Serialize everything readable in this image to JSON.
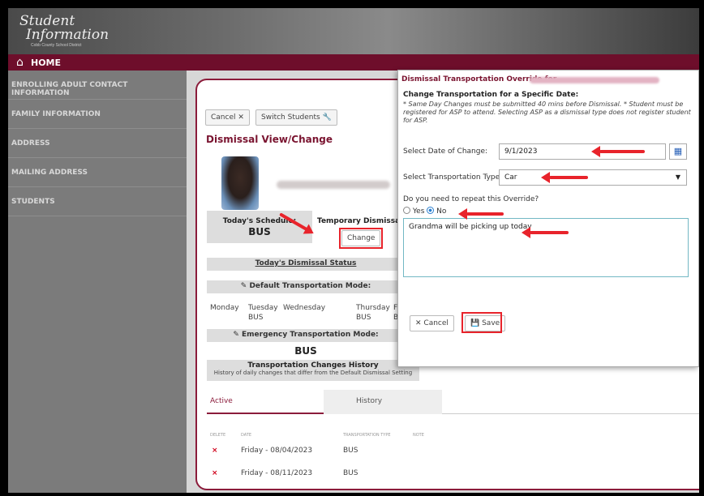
{
  "banner": {
    "logo_line1": "Student",
    "logo_line2": "Information",
    "logo_line3": "Cobb County School District"
  },
  "home": {
    "icon": "home-icon",
    "label": "HOME"
  },
  "sidebar": {
    "items": [
      {
        "label": "ENROLLING ADULT CONTACT INFORMATION"
      },
      {
        "label": "FAMILY INFORMATION"
      },
      {
        "label": "ADDRESS"
      },
      {
        "label": "MAILING ADDRESS"
      },
      {
        "label": "STUDENTS"
      }
    ]
  },
  "toolbar": {
    "cancel_label": "Cancel",
    "cancel_icon": "close-icon",
    "switch_label": "Switch Students",
    "switch_icon": "wrench-icon"
  },
  "dismissal": {
    "title": "Dismissal View/Change",
    "todays_schedule_label": "Today's Schedule:",
    "todays_schedule_value": "BUS",
    "temp_dismissal_label": "Temporary Dismissal Cl",
    "change_label": "Change",
    "status_link": "Today's Dismissal Status",
    "default_mode_label": "Default Transportation Mode:",
    "days": [
      {
        "day": "Monday",
        "value": ""
      },
      {
        "day": "Tuesday",
        "value": "BUS"
      },
      {
        "day": "Wednesday",
        "value": ""
      },
      {
        "day": "Thursday",
        "value": "BUS"
      },
      {
        "day": "Fr",
        "value": "B"
      }
    ],
    "emergency_label": "Emergency Transportation Mode:",
    "emergency_value": "BUS",
    "history_title": "Transportation Changes History",
    "history_sub": "History of daily changes that differ from the Default Dismissal Setting"
  },
  "tabs": [
    {
      "label": "Active"
    },
    {
      "label": "History"
    }
  ],
  "table": {
    "headers": [
      "DELETE",
      "DATE",
      "TRANSPORTATION TYPE",
      "NOTE"
    ],
    "rows": [
      {
        "delete": "×",
        "date": "Friday - 08/04/2023",
        "type": "BUS",
        "note": ""
      },
      {
        "delete": "×",
        "date": "Friday - 08/11/2023",
        "type": "BUS",
        "note": ""
      }
    ]
  },
  "modal": {
    "title": "Dismissal Transportation Override for",
    "subtitle": "Change Transportation for a Specific Date:",
    "note": "* Same Day Changes must be submitted 40 mins before Dismissal. * Student must be registered for ASP to attend. Selecting ASP as a dismissal type does not register student for ASP.",
    "date_label": "Select Date of Change:",
    "date_value": "9/1/2023",
    "date_icon": "calendar-icon",
    "type_label": "Select Transportation Type:",
    "type_value": "Car",
    "type_icon": "chevron-down-icon",
    "repeat_label": "Do you need to repeat this Override?",
    "repeat_yes": "Yes",
    "repeat_no": "No",
    "repeat_selected": "No",
    "note_value": "Grandma will be picking up today",
    "cancel_label": "Cancel",
    "save_label": "Save",
    "save_icon": "floppy-icon"
  },
  "colors": {
    "brand": "#6e0e2b",
    "annotation": "#e8232b",
    "accent": "#2a7fd0"
  }
}
